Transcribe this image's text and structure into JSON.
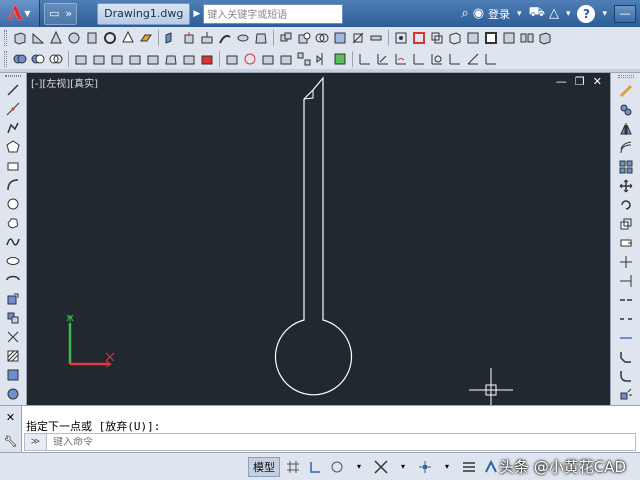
{
  "titlebar": {
    "app_logo": "A",
    "doc_title": "Drawing1.dwg",
    "search_placeholder": "键入关键字或短语",
    "login_label": "登录",
    "help_label": "?"
  },
  "viewport": {
    "label": "[-][左视][真实]"
  },
  "command": {
    "history_line": "指定下一点或 [放弃(U)]:",
    "prompt_symbol": "≫",
    "input_placeholder": "键入命令"
  },
  "status": {
    "model_label": "模型"
  },
  "watermark": {
    "text": "头条 @小黄花CAD"
  },
  "colors": {
    "viewport_bg": "#212830",
    "drawing_stroke": "#ffffff",
    "ucs_x": "#e03a3a",
    "ucs_y": "#3dbb4a"
  },
  "icons": {
    "toolbar1": [
      "box",
      "wedge",
      "cone",
      "sphere",
      "cylinder",
      "torus",
      "pyramid",
      "planar-surface",
      "polysolid",
      "extrude",
      "press-pull",
      "sweep",
      "revolve",
      "loft",
      "union",
      "subtract",
      "intersect",
      "interfere",
      "slice",
      "thicken",
      "imprint",
      "color-edges",
      "copy-edges",
      "extract-edges",
      "offset-edges",
      "shell",
      "check",
      "separate",
      "clean"
    ],
    "toolbar2": [
      "union",
      "subtract",
      "intersect",
      "interfere",
      "slice",
      "imprint",
      "solid-edit",
      "extrude-faces",
      "move-faces",
      "offset-faces",
      "delete-faces",
      "rotate-faces",
      "taper-faces",
      "copy-faces",
      "color-faces",
      "3d-move",
      "3d-rotate",
      "3d-scale",
      "3d-align",
      "3d-array",
      "3d-mirror",
      "dimension-linear",
      "dimension-aligned",
      "dimension-arc",
      "dimension-ordinate",
      "dimension-radius",
      "dimension-diameter",
      "dimension-angular",
      "quick-dimension"
    ],
    "left": [
      "line",
      "construction-line",
      "polyline",
      "polygon",
      "rectangle",
      "arc",
      "circle",
      "revision-cloud",
      "spline",
      "ellipse",
      "ellipse-arc",
      "insert-block",
      "make-block",
      "point",
      "hatch",
      "gradient",
      "region",
      "table",
      "multiline-text"
    ],
    "right": [
      "erase",
      "copy",
      "mirror",
      "offset",
      "array",
      "move",
      "rotate",
      "scale",
      "stretch",
      "trim",
      "extend",
      "break-at-point",
      "break",
      "join",
      "chamfer",
      "fillet",
      "explode"
    ],
    "status": [
      "grid",
      "snap-mode",
      "ortho",
      "polar",
      "osnap",
      "3d-osnap",
      "otrack",
      "ducs",
      "dyn",
      "lineweight",
      "transparency",
      "annotation-scale"
    ]
  }
}
